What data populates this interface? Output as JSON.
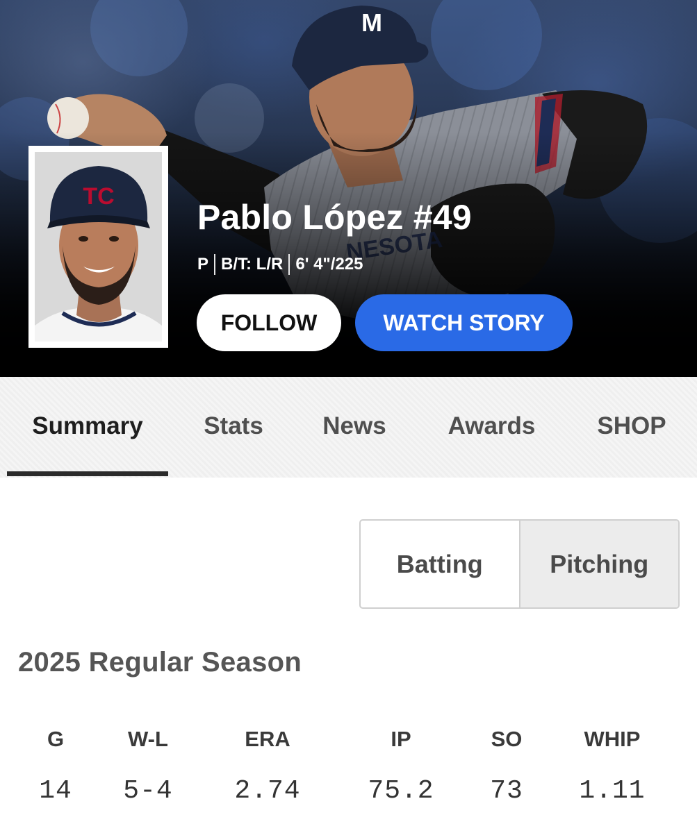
{
  "hero": {
    "player_name": "Pablo López #49",
    "position": "P",
    "bats_throws": "B/T: L/R",
    "height_weight": "6' 4\"/225",
    "follow_label": "FOLLOW",
    "watch_story_label": "WATCH STORY",
    "colors": {
      "story_button": "#2a6ae6",
      "hero_dark": "#000000"
    }
  },
  "tabs": [
    {
      "label": "Summary",
      "active": true
    },
    {
      "label": "Stats"
    },
    {
      "label": "News"
    },
    {
      "label": "Awards"
    },
    {
      "label": "SHOP"
    }
  ],
  "stat_toggle": {
    "options": [
      "Batting",
      "Pitching"
    ],
    "selected": "Pitching"
  },
  "season": {
    "title": "2025 Regular Season",
    "columns": [
      "G",
      "W-L",
      "ERA",
      "IP",
      "SO",
      "WHIP"
    ],
    "values": [
      "14",
      "5-4",
      "2.74",
      "75.2",
      "73",
      "1.11"
    ]
  },
  "icons": {
    "cap_logo_hero": "M",
    "cap_logo_headshot": "TC"
  }
}
